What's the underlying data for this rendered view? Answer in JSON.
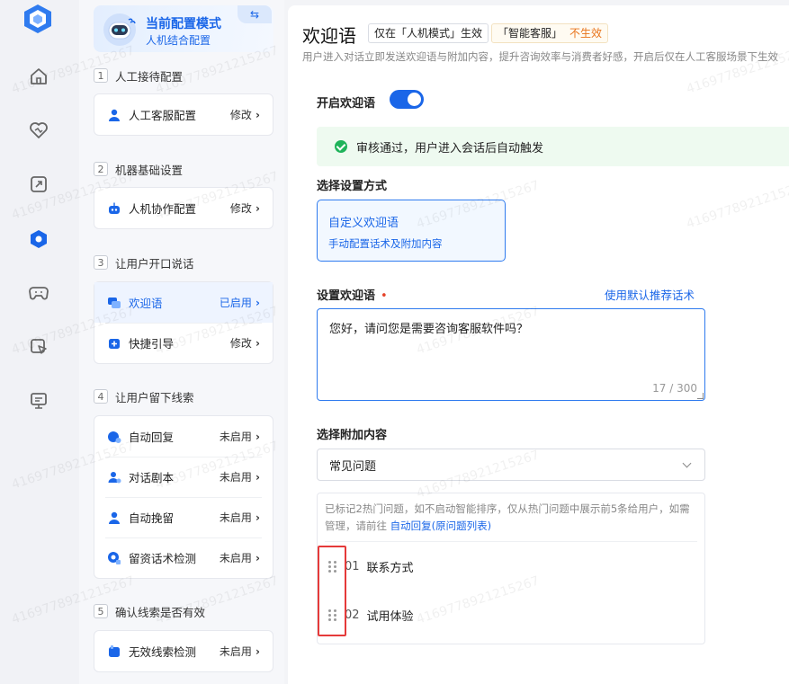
{
  "mode": {
    "title": "当前配置模式",
    "subtitle": "人机结合配置",
    "swap_icon": "swap-icon"
  },
  "sections": [
    {
      "num": "1",
      "label": "人工接待配置",
      "items": [
        {
          "label": "人工客服配置",
          "status": "修改"
        }
      ]
    },
    {
      "num": "2",
      "label": "机器基础设置",
      "items": [
        {
          "label": "人机协作配置",
          "status": "修改"
        }
      ]
    },
    {
      "num": "3",
      "label": "让用户开口说话",
      "items": [
        {
          "label": "欢迎语",
          "status": "已启用"
        },
        {
          "label": "快捷引导",
          "status": "修改"
        }
      ]
    },
    {
      "num": "4",
      "label": "让用户留下线索",
      "items": [
        {
          "label": "自动回复",
          "status": "未启用"
        },
        {
          "label": "对话剧本",
          "status": "未启用"
        },
        {
          "label": "自动挽留",
          "status": "未启用"
        },
        {
          "label": "留资话术检测",
          "status": "未启用"
        }
      ]
    },
    {
      "num": "5",
      "label": "确认线索是否有效",
      "items": [
        {
          "label": "无效线索检测",
          "status": "未启用"
        }
      ]
    }
  ],
  "main": {
    "title": "欢迎语",
    "tag1": "仅在「人机模式」生效",
    "tag2_prefix": "「智能客服」",
    "tag2_warn": "不生效",
    "description": "用户进入对话立即发送欢迎语与附加内容，提升咨询效率与消费者好感，开启后仅在人工客服场景下生效",
    "toggle_label": "开启欢迎语",
    "toggle_on": true,
    "approval_text": "审核通过，用户进入会话后自动触发",
    "method_label": "选择设置方式",
    "method_card_title": "自定义欢迎语",
    "method_card_sub": "手动配置话术及附加内容",
    "greeting_label": "设置欢迎语",
    "required_mark": "•",
    "use_default_link": "使用默认推荐话术",
    "greeting_value": "您好，请问您是需要咨询客服软件吗？",
    "greeting_count": "17 / 300",
    "attach_label": "选择附加内容",
    "attach_selected": "常见问题",
    "faq_note": "已标记2热门问题，如不启动智能排序，仅从热门问题中展示前5条给用户，如需管理，请前往",
    "faq_note_link": "自动回复(原问题列表)",
    "faq_items": [
      {
        "idx": "01",
        "label": "联系方式"
      },
      {
        "idx": "02",
        "label": "试用体验"
      }
    ]
  },
  "watermark": "416977892121526​7",
  "colors": {
    "accent": "#1a66e8",
    "success": "#1fb35a",
    "warn": "#e8731a",
    "highlight": "#e53a3a"
  }
}
